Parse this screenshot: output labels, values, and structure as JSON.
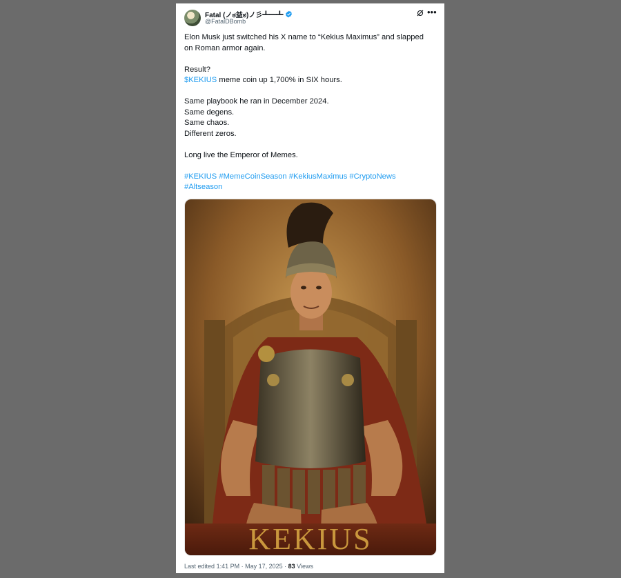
{
  "tweet": {
    "author_name": "Fatal (ノಠ益ಠ)ノ彡┻━┻",
    "handle": "@FatalDBomb",
    "paragraphs": {
      "p1": "Elon Musk just switched his X name to “Kekius Maximus” and slapped on Roman armor again.",
      "p2_l1": "Result?",
      "p2_ticker": "$KEKIUS",
      "p2_rest": " meme coin up 1,700% in SIX hours.",
      "p3_l1": "Same playbook he ran in December 2024.",
      "p3_l2": "Same degens.",
      "p3_l3": "Same chaos.",
      "p3_l4": "Different zeros.",
      "p4": "Long live the Emperor of Memes.",
      "hashtags": [
        "#KEKIUS",
        "#MemeCoinSeason",
        "#KekiusMaximus",
        "#CryptoNews",
        "#Altseason"
      ]
    },
    "image_caption": "KEKIUS",
    "footer": {
      "edited": "Last edited",
      "time": "1:41 PM · May 17, 2025",
      "separator": " · ",
      "views_count": "83",
      "views_label": "Views"
    }
  },
  "colors": {
    "link": "#1d9bf0",
    "verified": "#1d9bf0",
    "backdrop": "#6b6b6b"
  },
  "icons": [
    "verified-badge-icon",
    "grok-icon",
    "more-options-icon"
  ]
}
